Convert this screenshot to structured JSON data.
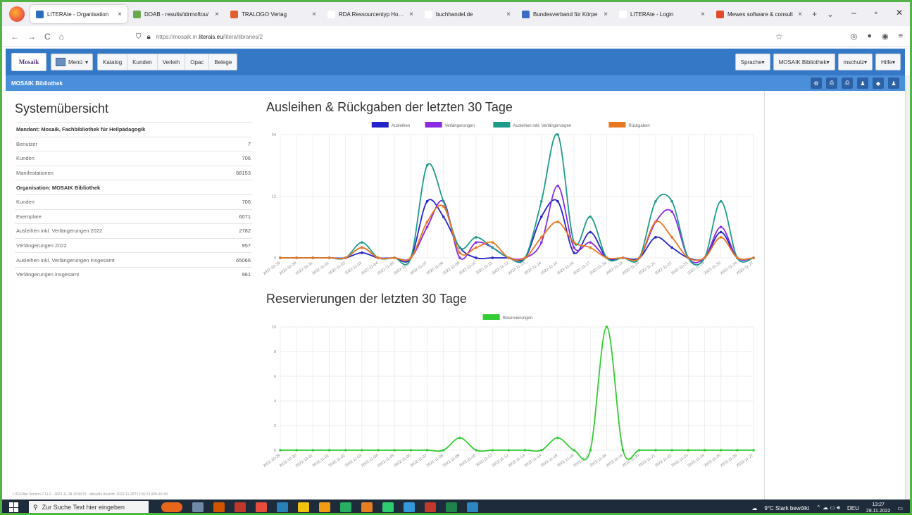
{
  "browser": {
    "tabs": [
      {
        "label": "LITERAte - Organisation",
        "color": "#2d6dbd",
        "active": true
      },
      {
        "label": "DOAB - results/idrmoftou/",
        "color": "#6aa84f",
        "active": false
      },
      {
        "label": "TRALOGO Verlag",
        "color": "#e06030",
        "active": false
      },
      {
        "label": "RDA Ressourcentyp Hochschu",
        "color": "#ffffff",
        "active": false
      },
      {
        "label": "buchhandel.de",
        "color": "#ffffff",
        "active": false
      },
      {
        "label": "Bundesverband für Körpe",
        "color": "#3a6ec4",
        "active": false
      },
      {
        "label": "LITERAte - Login",
        "color": "#ffffff",
        "active": false
      },
      {
        "label": "Mewes software & consult",
        "color": "#e04b2a",
        "active": false
      }
    ],
    "url_prefix": "https://mosaik.m.",
    "url_host": "literais.eu",
    "url_path": "/litera/libraries/2"
  },
  "toolbar": {
    "logo_text": "Mosaik",
    "menu_label": "Menü",
    "nav_items": [
      "Katalog",
      "Kunden",
      "Verleih",
      "Opac",
      "Belege"
    ],
    "right_items": [
      "Sprache",
      "MOSAIK Bibliothek",
      "mschulz",
      "Hilfe"
    ]
  },
  "subheader": {
    "title": "MOSAIK Bibliothek"
  },
  "system": {
    "title": "Systemübersicht",
    "rows": [
      {
        "label": "Mandant: Mosaik, Fachbibliothek für Heilpädagogik",
        "value": "",
        "head": true
      },
      {
        "label": "Benutzer",
        "value": "7",
        "head": false
      },
      {
        "label": "Kunden",
        "value": "706",
        "head": false
      },
      {
        "label": "Manifestationen",
        "value": "68153",
        "head": false
      },
      {
        "label": "Organisation: MOSAIK Bibliothek",
        "value": "",
        "head": true
      },
      {
        "label": "Kunden",
        "value": "706",
        "head": false
      },
      {
        "label": "Exemplare",
        "value": "6071",
        "head": false
      },
      {
        "label": "Ausleihen inkl. Verlängerungen 2022",
        "value": "2782",
        "head": false
      },
      {
        "label": "Verlängerungen 2022",
        "value": "957",
        "head": false
      },
      {
        "label": "Ausleihen inkl. Verlängerungen insgesamt",
        "value": "65066",
        "head": false
      },
      {
        "label": "Verlängerungen insgesamt",
        "value": "961",
        "head": false
      }
    ],
    "footer_note": "LITERAte Version 2.11.0 - 2022-11-28 20:00:01 - Aktuelle Ansicht: 2022-11-28T12:26:23.009+01:00"
  },
  "chart_data": [
    {
      "type": "line",
      "title": "Ausleihen & Rückgaben der letzten 30 Tage",
      "xlabel": "",
      "ylabel": "",
      "ylim": [
        0,
        24
      ],
      "yticks": [
        0,
        12,
        24
      ],
      "legend_position": "top-center",
      "grid": true,
      "categories": [
        "2022-10-29",
        "2022-10-30",
        "2022-10-31",
        "2022-11-01",
        "2022-11-02",
        "2022-11-03",
        "2022-11-04",
        "2022-11-05",
        "2022-11-06",
        "2022-11-07",
        "2022-11-08",
        "2022-11-09",
        "2022-11-10",
        "2022-11-11",
        "2022-11-12",
        "2022-11-13",
        "2022-11-14",
        "2022-11-15",
        "2022-11-16",
        "2022-11-17",
        "2022-11-18",
        "2022-11-19",
        "2022-11-20",
        "2022-11-21",
        "2022-11-22",
        "2022-11-23",
        "2022-11-24",
        "2022-11-25",
        "2022-11-26",
        "2022-11-27"
      ],
      "series": [
        {
          "name": "Ausleihen",
          "color": "#2424c8",
          "values": [
            0,
            0,
            0,
            0,
            0,
            1,
            0,
            0,
            0,
            11,
            8,
            2,
            0,
            0,
            0,
            0,
            8,
            11,
            1,
            5,
            0,
            0,
            0,
            4,
            2,
            0,
            0,
            5,
            0,
            0
          ]
        },
        {
          "name": "Verlängerungen",
          "color": "#8a2be2",
          "values": [
            0,
            0,
            0,
            0,
            0,
            2,
            0,
            0,
            0,
            6,
            11,
            0,
            3,
            2,
            0,
            0,
            3,
            14,
            2,
            3,
            0,
            0,
            0,
            7,
            9,
            0,
            0,
            6,
            0,
            0
          ]
        },
        {
          "name": "Ausleihen inkl. Verlängerungen",
          "color": "#1e9a8a",
          "values": [
            0,
            0,
            0,
            0,
            0,
            3,
            0,
            0,
            0,
            18,
            11,
            2,
            4,
            2,
            0,
            0,
            11,
            24,
            3,
            8,
            0,
            0,
            0,
            11,
            11,
            0,
            0,
            11,
            0,
            0
          ]
        },
        {
          "name": "Rückgaben",
          "color": "#e87722",
          "values": [
            0,
            0,
            0,
            0,
            0,
            2,
            0,
            0,
            0,
            7,
            10,
            1,
            2,
            3,
            0,
            0,
            4,
            7,
            3,
            2,
            0,
            0,
            0,
            7,
            4,
            0,
            0,
            4,
            0,
            0
          ]
        }
      ]
    },
    {
      "type": "line",
      "title": "Reservierungen der letzten 30 Tage",
      "xlabel": "",
      "ylabel": "",
      "ylim": [
        0,
        10
      ],
      "yticks": [
        0,
        2,
        4,
        6,
        8,
        10
      ],
      "legend_position": "top-center",
      "grid": true,
      "categories": [
        "2022-10-29",
        "2022-10-30",
        "2022-10-31",
        "2022-11-01",
        "2022-11-02",
        "2022-11-03",
        "2022-11-04",
        "2022-11-05",
        "2022-11-06",
        "2022-11-07",
        "2022-11-08",
        "2022-11-09",
        "2022-11-10",
        "2022-11-11",
        "2022-11-12",
        "2022-11-13",
        "2022-11-14",
        "2022-11-15",
        "2022-11-16",
        "2022-11-17",
        "2022-11-18",
        "2022-11-19",
        "2022-11-20",
        "2022-11-21",
        "2022-11-22",
        "2022-11-23",
        "2022-11-24",
        "2022-11-25",
        "2022-11-26",
        "2022-11-27"
      ],
      "series": [
        {
          "name": "Reservierungen",
          "color": "#33cc33",
          "values": [
            0,
            0,
            0,
            0,
            0,
            0,
            0,
            0,
            0,
            0,
            0,
            1,
            0,
            0,
            0,
            0,
            0,
            1,
            0,
            0,
            10,
            0,
            0,
            0,
            0,
            0,
            0,
            0,
            0,
            0
          ]
        }
      ]
    }
  ],
  "taskbar": {
    "search_placeholder": "Zur Suche Text hier eingeben",
    "weather": "9°C Stark bewölkt",
    "lang": "DEU",
    "time": "13:27",
    "date": "28.11.2022"
  }
}
